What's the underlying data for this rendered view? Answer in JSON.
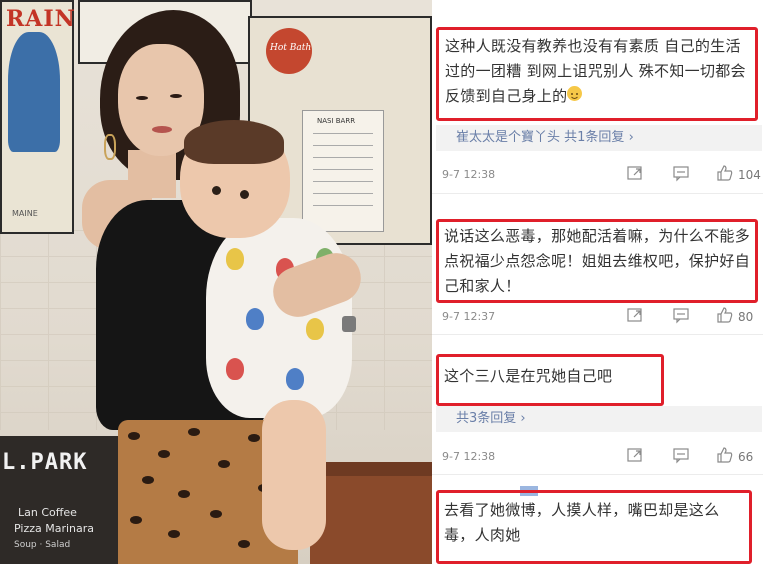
{
  "photo": {
    "poster_left_text": "RAIN",
    "poster_left_foot": "MAINE",
    "poster_right_badge": "Hot Bath",
    "menu_title": "NASI BARR",
    "sign_title": "L.PARK",
    "sign_line1": "Lan Coffee",
    "sign_line2": "Pizza Marinara",
    "sign_line3": "Soup · Salad"
  },
  "comments": [
    {
      "text": "这种人既没有教养也没有有素质 自己的生活过的一团糟 到网上诅咒别人 殊不知一切都会反馈到自己身上的",
      "emoji": "smiley-emoji",
      "reply_summary_prefix": "崔太太是个寶丫头",
      "reply_summary_suffix": "共1条回复",
      "time": "9-7 12:38",
      "likes": "104"
    },
    {
      "text": "说话这么恶毒，那她配活着嘛，为什么不能多点祝福少点怨念呢！姐姐去维权吧，保护好自己和家人！",
      "time": "9-7 12:37",
      "likes": "80"
    },
    {
      "text": "这个三八是在咒她自己吧",
      "reply_summary": "共3条回复",
      "time": "9-7 12:38",
      "likes": "66"
    },
    {
      "text": "去看了她微博，人摸人样，嘴巴却是这么毒，人肉她"
    }
  ],
  "colors": {
    "highlight_box": "#e01f2a",
    "reply_link": "#6a7fa8",
    "meta_text": "#8a8a8a"
  }
}
